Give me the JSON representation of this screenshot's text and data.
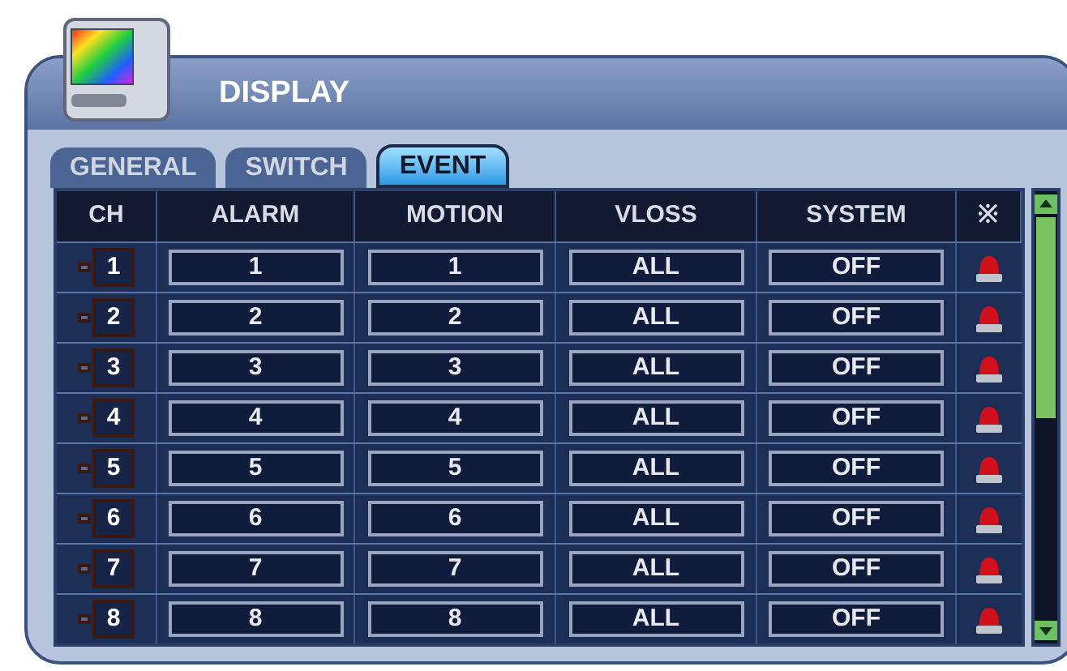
{
  "window": {
    "title": "DISPLAY"
  },
  "tabs": [
    {
      "label": "GENERAL",
      "selected": false
    },
    {
      "label": "SWITCH",
      "selected": false
    },
    {
      "label": "EVENT",
      "selected": true
    }
  ],
  "table": {
    "columns": [
      "CH",
      "ALARM",
      "MOTION",
      "VLOSS",
      "SYSTEM",
      "※"
    ],
    "rows": [
      {
        "ch": "1",
        "alarm": "1",
        "motion": "1",
        "vloss": "ALL",
        "system": "OFF"
      },
      {
        "ch": "2",
        "alarm": "2",
        "motion": "2",
        "vloss": "ALL",
        "system": "OFF"
      },
      {
        "ch": "3",
        "alarm": "3",
        "motion": "3",
        "vloss": "ALL",
        "system": "OFF"
      },
      {
        "ch": "4",
        "alarm": "4",
        "motion": "4",
        "vloss": "ALL",
        "system": "OFF"
      },
      {
        "ch": "5",
        "alarm": "5",
        "motion": "5",
        "vloss": "ALL",
        "system": "OFF"
      },
      {
        "ch": "6",
        "alarm": "6",
        "motion": "6",
        "vloss": "ALL",
        "system": "OFF"
      },
      {
        "ch": "7",
        "alarm": "7",
        "motion": "7",
        "vloss": "ALL",
        "system": "OFF"
      },
      {
        "ch": "8",
        "alarm": "8",
        "motion": "8",
        "vloss": "ALL",
        "system": "OFF"
      }
    ]
  }
}
